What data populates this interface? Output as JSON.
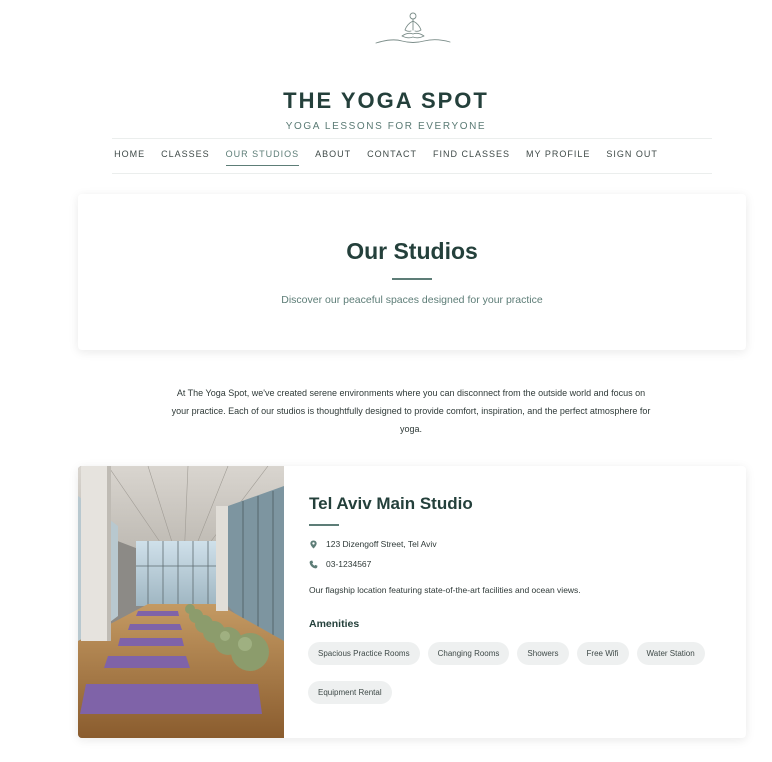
{
  "site": {
    "title": "THE YOGA SPOT",
    "tagline": "YOGA LESSONS FOR EVERYONE"
  },
  "icons": {
    "logo": "meditating-figure-icon",
    "address": "map-pin-icon",
    "phone": "phone-icon"
  },
  "nav": {
    "items": [
      {
        "label": "HOME",
        "active": false
      },
      {
        "label": "CLASSES",
        "active": false
      },
      {
        "label": "OUR STUDIOS",
        "active": true
      },
      {
        "label": "ABOUT",
        "active": false
      },
      {
        "label": "CONTACT",
        "active": false
      },
      {
        "label": "FIND CLASSES",
        "active": false
      },
      {
        "label": "MY PROFILE",
        "active": false
      },
      {
        "label": "SIGN OUT",
        "active": false
      }
    ]
  },
  "hero": {
    "title": "Our Studios",
    "subtitle": "Discover our peaceful spaces designed for your practice"
  },
  "intro": {
    "text": "At The Yoga Spot, we've created serene environments where you can disconnect from the outside world and focus on your practice. Each of our studios is thoughtfully designed to provide comfort, inspiration, and the perfect atmosphere for yoga."
  },
  "studio": {
    "name": "Tel Aviv Main Studio",
    "address": "123 Dizengoff Street, Tel Aviv",
    "phone": "03-1234567",
    "description": "Our flagship location featuring state-of-the-art facilities and ocean views.",
    "amenities_title": "Amenities",
    "amenities": [
      "Spacious Practice Rooms",
      "Changing Rooms",
      "Showers",
      "Free Wifi",
      "Water Station",
      "Equipment Rental"
    ]
  },
  "colors": {
    "accent": "#5d7d77",
    "heading": "#24403b",
    "chip_bg": "#eef0f0"
  }
}
